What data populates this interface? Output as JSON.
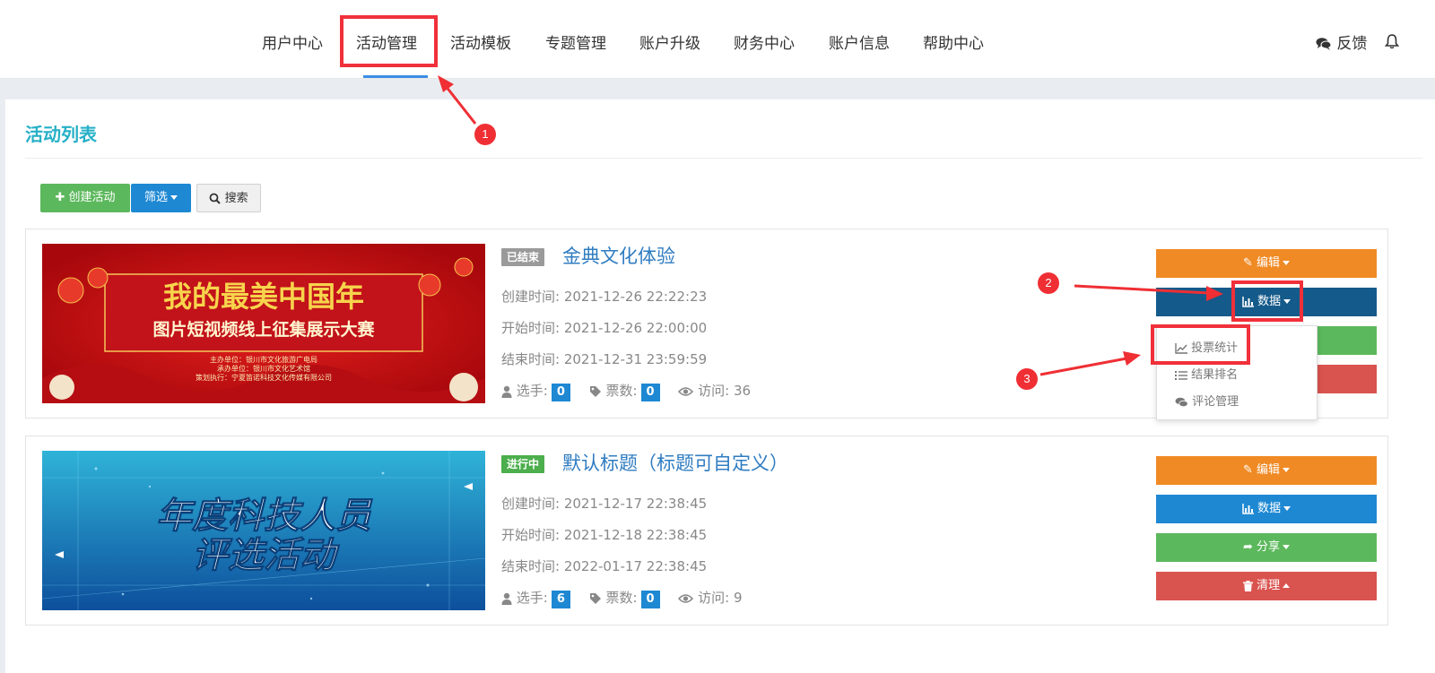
{
  "nav": {
    "items": [
      "用户中心",
      "活动管理",
      "活动模板",
      "专题管理",
      "账户升级",
      "财务中心",
      "账户信息",
      "帮助中心"
    ],
    "active_index": 1,
    "feedback_label": "反馈"
  },
  "annotations": [
    "1",
    "2",
    "3"
  ],
  "page_title": "活动列表",
  "toolbar": {
    "create_label": "创建活动",
    "filter_label": "筛选",
    "search_label": "搜索"
  },
  "labels": {
    "created": "创建时间:",
    "start": "开始时间:",
    "end": "结束时间:",
    "players": "选手:",
    "votes": "票数:",
    "visits": "访问:"
  },
  "activities": [
    {
      "status": "已结束",
      "title": "金典文化体验",
      "created": "2021-12-26 22:22:23",
      "start": "2021-12-26 22:00:00",
      "end": "2021-12-31 23:59:59",
      "players": "0",
      "votes": "0",
      "visits": "36",
      "banner": {
        "line1": "我的最美中国年",
        "line2": "图片短视频线上征集展示大赛",
        "small1": "主办单位：银川市文化旅游广电局",
        "small2": "承办单位：银川市文化艺术馆",
        "small3": "策划执行：宁夏笛诺科技文化传媒有限公司"
      },
      "buttons": {
        "edit": "编辑",
        "data": "数据"
      }
    },
    {
      "status": "进行中",
      "title": "默认标题（标题可自定义）",
      "created": "2021-12-17 22:38:45",
      "start": "2021-12-18 22:38:45",
      "end": "2022-01-17 22:38:45",
      "players": "6",
      "votes": "0",
      "visits": "9",
      "banner": {
        "line1": "年度科技人员",
        "line2": "评选活动"
      },
      "buttons": {
        "edit": "编辑",
        "data": "数据",
        "share": "分享",
        "clear": "清理"
      }
    }
  ],
  "dropdown": {
    "items": [
      "投票统计",
      "结果排名",
      "评论管理"
    ]
  },
  "colors": {
    "accent_teal": "#26b0c7",
    "nav_underline": "#3a8ee6",
    "orange": "#f08a24",
    "dark_blue": "#145a8a",
    "blue": "#1e88d3",
    "green": "#5cb85c",
    "red": "#d9534f",
    "annotation_red": "#ef2f34"
  }
}
